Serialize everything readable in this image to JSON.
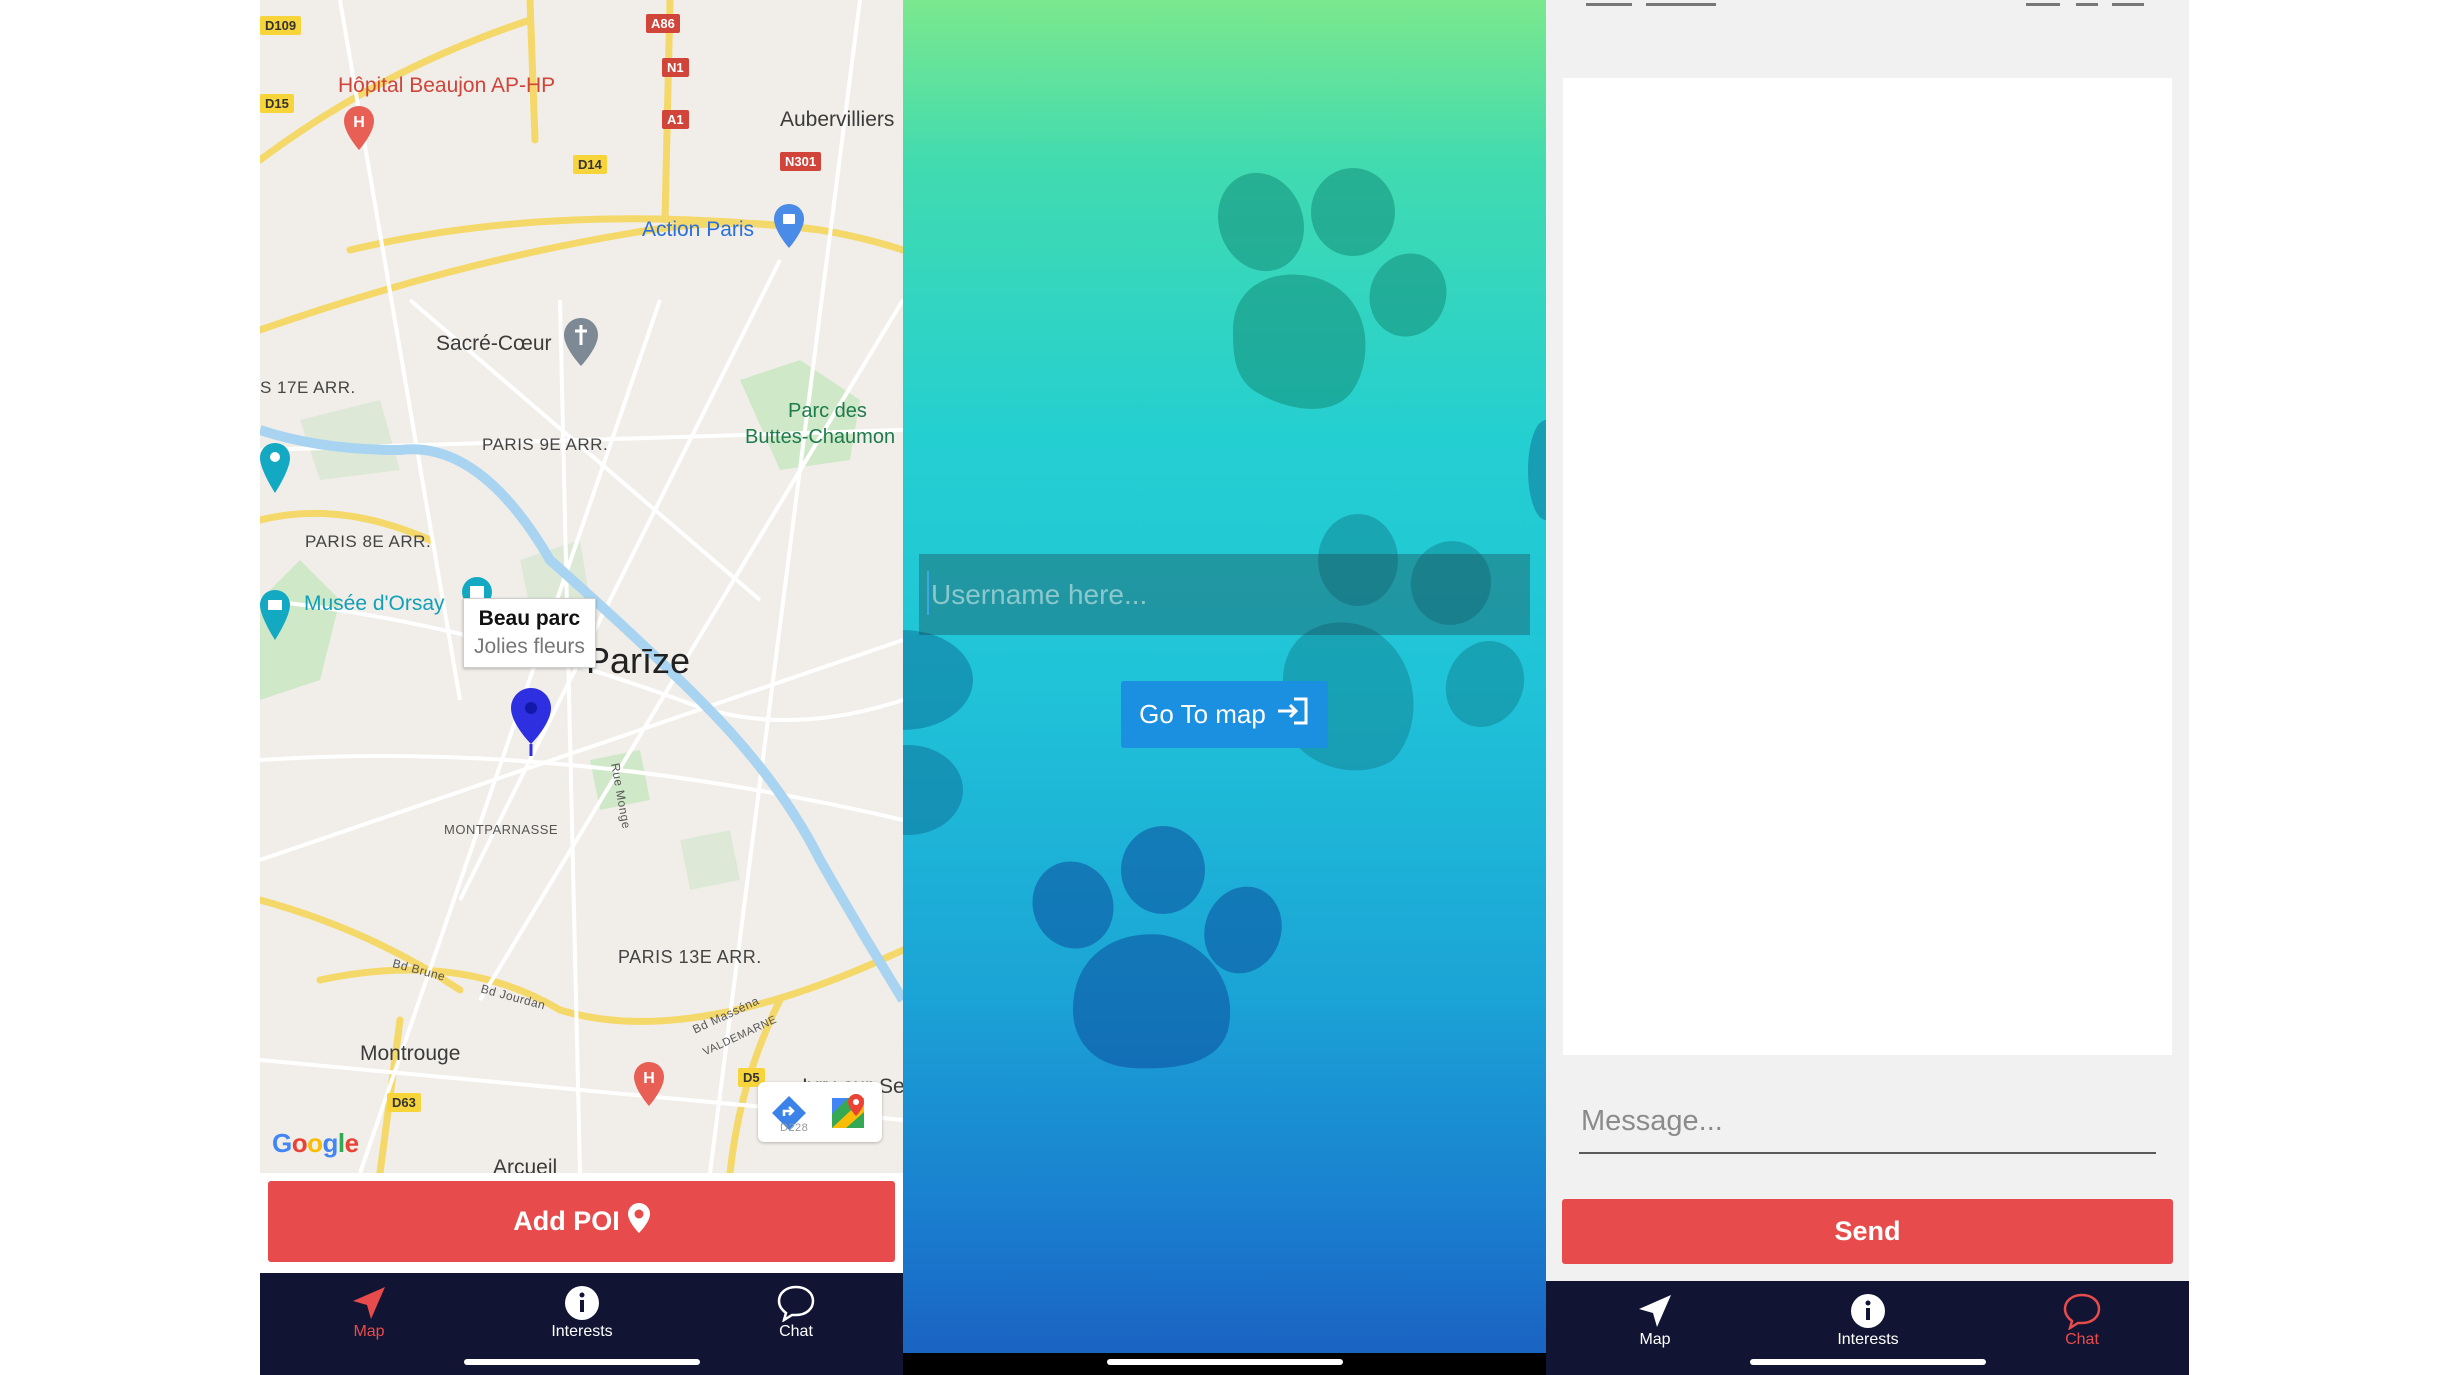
{
  "map_screen": {
    "labels": {
      "hopital_beaujon": "Hôpital Beaujon AP-HP",
      "aubervilliers": "Aubervilliers",
      "action_paris": "Action Paris",
      "sacre_coeur": "Sacré-Cœur",
      "paris_17": "S 17E ARR.",
      "parc_des": "Parc des",
      "buttes": "Buttes-Chaumon",
      "paris_9": "PARIS 9E ARR.",
      "paris_8": "PARIS 8E ARR.",
      "musee_orsay": "Musée d'Orsay",
      "parize": "Parīze",
      "montparnasse": "MONTPARNASSE",
      "rue_monge": "Rue Monge",
      "paris_13": "PARIS 13E ARR.",
      "bd_brune": "Bd Brune",
      "bd_jourdan": "Bd Jourdan",
      "bd_massena": "Bd Masséna",
      "valdemarne": "VALDEMARNE",
      "montrouge": "Montrouge",
      "arcueil": "Arcueil",
      "ivry": "Ivry-sur-Se",
      "d228": "D228"
    },
    "road_badges": {
      "a86": "A86",
      "n1": "N1",
      "a1": "A1",
      "n301": "N301",
      "d14": "D14",
      "d15": "D15",
      "d109": "D109",
      "d63": "D63",
      "d5": "D5"
    },
    "callout": {
      "title": "Beau parc",
      "subtitle": "Jolies fleurs"
    },
    "google": {
      "g1": "G",
      "o1": "o",
      "o2": "o",
      "g2": "g",
      "l": "l",
      "e": "e"
    },
    "add_poi_label": "Add POI",
    "tabs": {
      "map": "Map",
      "interests": "Interests",
      "chat": "Chat"
    }
  },
  "login_screen": {
    "username_placeholder": "Username here...",
    "go_to_map_label": "Go To map"
  },
  "chat_screen": {
    "message_placeholder": "Message...",
    "send_label": "Send",
    "tabs": {
      "map": "Map",
      "interests": "Interests",
      "chat": "Chat"
    }
  },
  "colors": {
    "accent_red": "#e84b4b",
    "tabbar_bg": "#111533",
    "button_blue": "#1b8fe0",
    "pin_blue": "#2d2fe0"
  },
  "active_tabs": {
    "map_screen": "map",
    "chat_screen": "chat"
  }
}
